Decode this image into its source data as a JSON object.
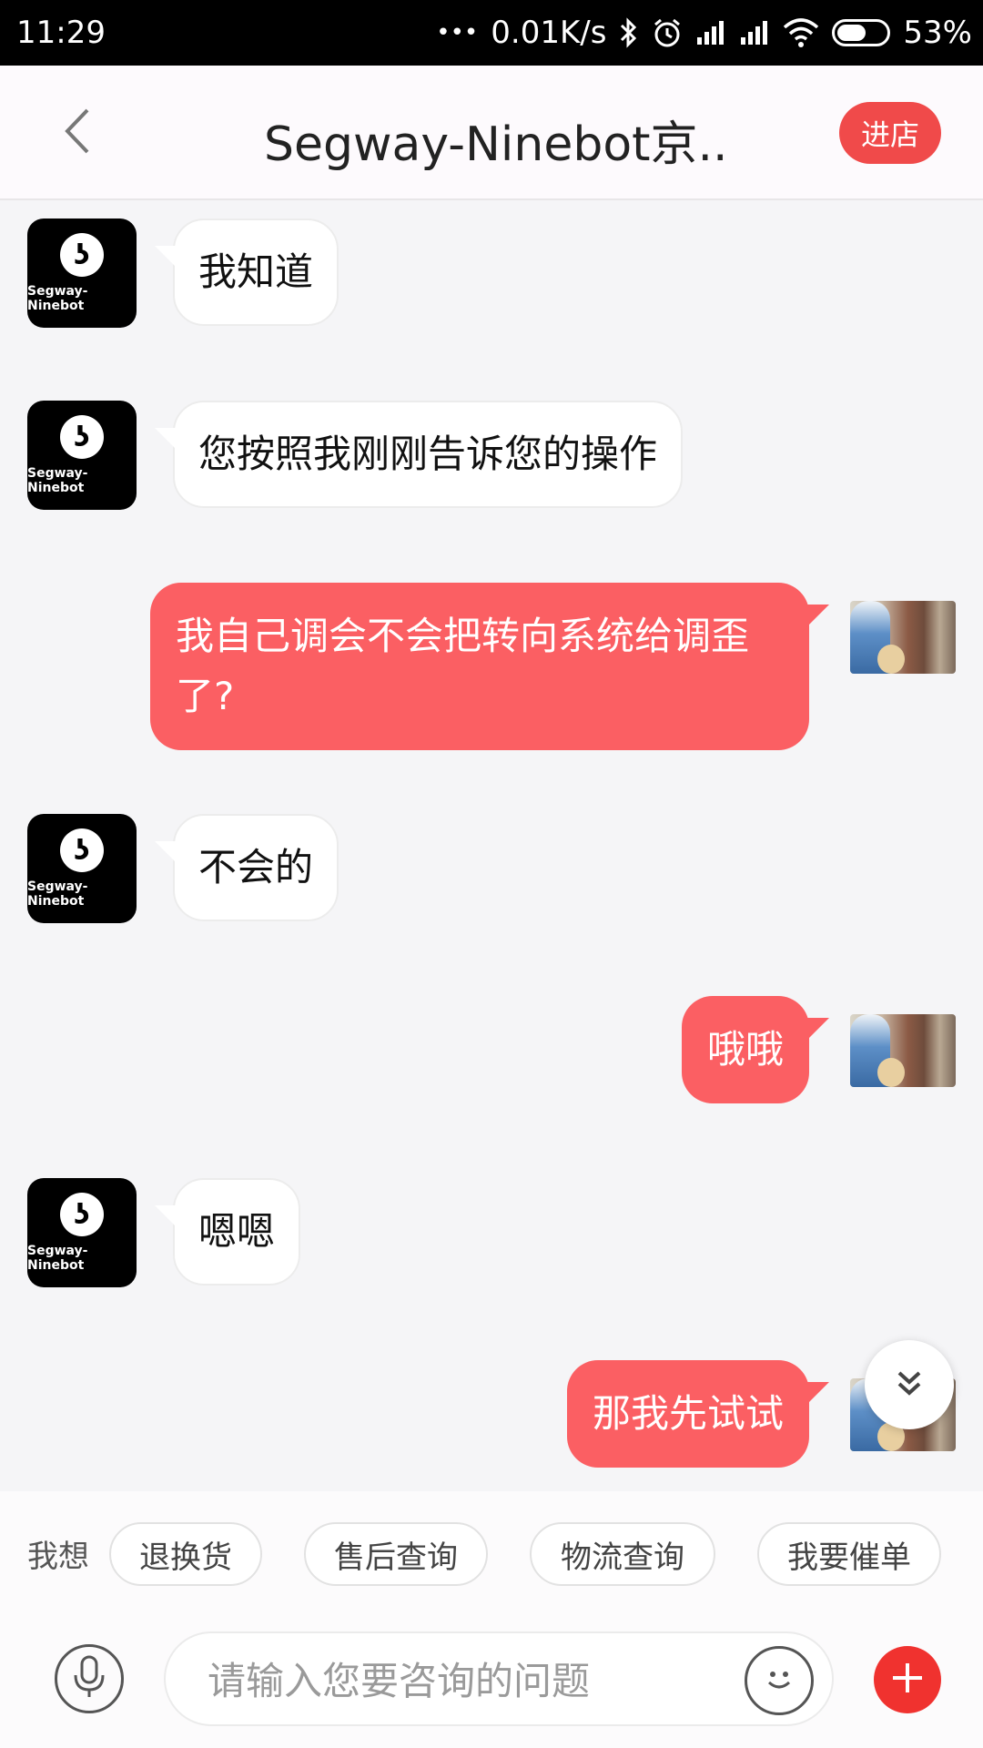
{
  "status_bar": {
    "time": "11:29",
    "dots": "•••",
    "net_speed": "0.01K/s",
    "battery": "53%",
    "battery_level": 0.53
  },
  "header": {
    "back_icon": "chevron-left-icon",
    "title": "Segway-Ninebot京...",
    "shop_button": "进店"
  },
  "brand_avatar_text": "Segway-Ninebot",
  "messages": [
    {
      "from": "shop",
      "text": "我知道"
    },
    {
      "from": "shop",
      "text": "您按照我刚刚告诉您的操作"
    },
    {
      "from": "user",
      "text": "我自己调会不会把转向系统给调歪了?"
    },
    {
      "from": "shop",
      "text": "不会的"
    },
    {
      "from": "user",
      "text": "哦哦"
    },
    {
      "from": "shop",
      "text": "嗯嗯"
    },
    {
      "from": "user",
      "text": "那我先试试"
    }
  ],
  "quick_actions": {
    "label": "我想",
    "chips": [
      "退换货",
      "售后查询",
      "物流查询",
      "我要催单"
    ]
  },
  "input": {
    "placeholder": "请输入您要咨询的问题",
    "value": ""
  },
  "colors": {
    "accent": "#f04a4a",
    "user_bubble": "#fb5f63",
    "plus_button": "#f0322f"
  }
}
